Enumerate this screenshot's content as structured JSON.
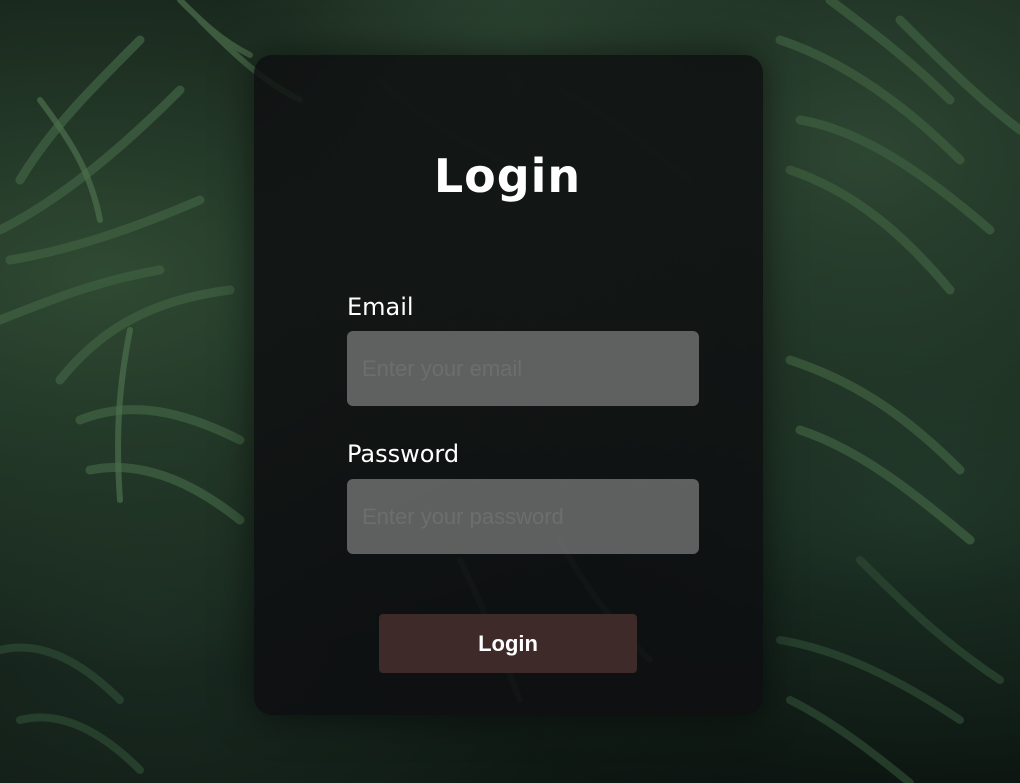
{
  "form": {
    "title": "Login",
    "email_label": "Email",
    "email_placeholder": "Enter your email",
    "email_value": "",
    "password_label": "Password",
    "password_placeholder": "Enter your password",
    "password_value": "",
    "submit_label": "Login"
  },
  "colors": {
    "card_background": "#0e0e10",
    "input_background": "#a0a0a0",
    "button_background": "#3e2a29",
    "text": "#ffffff"
  }
}
